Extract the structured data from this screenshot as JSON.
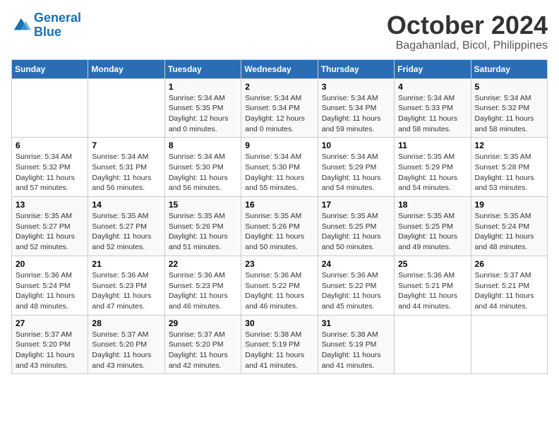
{
  "header": {
    "logo_line1": "General",
    "logo_line2": "Blue",
    "month": "October 2024",
    "location": "Bagahanlad, Bicol, Philippines"
  },
  "weekdays": [
    "Sunday",
    "Monday",
    "Tuesday",
    "Wednesday",
    "Thursday",
    "Friday",
    "Saturday"
  ],
  "weeks": [
    [
      {
        "day": "",
        "info": ""
      },
      {
        "day": "",
        "info": ""
      },
      {
        "day": "1",
        "info": "Sunrise: 5:34 AM\nSunset: 5:35 PM\nDaylight: 12 hours and 0 minutes."
      },
      {
        "day": "2",
        "info": "Sunrise: 5:34 AM\nSunset: 5:34 PM\nDaylight: 12 hours and 0 minutes."
      },
      {
        "day": "3",
        "info": "Sunrise: 5:34 AM\nSunset: 5:34 PM\nDaylight: 11 hours and 59 minutes."
      },
      {
        "day": "4",
        "info": "Sunrise: 5:34 AM\nSunset: 5:33 PM\nDaylight: 11 hours and 58 minutes."
      },
      {
        "day": "5",
        "info": "Sunrise: 5:34 AM\nSunset: 5:32 PM\nDaylight: 11 hours and 58 minutes."
      }
    ],
    [
      {
        "day": "6",
        "info": "Sunrise: 5:34 AM\nSunset: 5:32 PM\nDaylight: 11 hours and 57 minutes."
      },
      {
        "day": "7",
        "info": "Sunrise: 5:34 AM\nSunset: 5:31 PM\nDaylight: 11 hours and 56 minutes."
      },
      {
        "day": "8",
        "info": "Sunrise: 5:34 AM\nSunset: 5:30 PM\nDaylight: 11 hours and 56 minutes."
      },
      {
        "day": "9",
        "info": "Sunrise: 5:34 AM\nSunset: 5:30 PM\nDaylight: 11 hours and 55 minutes."
      },
      {
        "day": "10",
        "info": "Sunrise: 5:34 AM\nSunset: 5:29 PM\nDaylight: 11 hours and 54 minutes."
      },
      {
        "day": "11",
        "info": "Sunrise: 5:35 AM\nSunset: 5:29 PM\nDaylight: 11 hours and 54 minutes."
      },
      {
        "day": "12",
        "info": "Sunrise: 5:35 AM\nSunset: 5:28 PM\nDaylight: 11 hours and 53 minutes."
      }
    ],
    [
      {
        "day": "13",
        "info": "Sunrise: 5:35 AM\nSunset: 5:27 PM\nDaylight: 11 hours and 52 minutes."
      },
      {
        "day": "14",
        "info": "Sunrise: 5:35 AM\nSunset: 5:27 PM\nDaylight: 11 hours and 52 minutes."
      },
      {
        "day": "15",
        "info": "Sunrise: 5:35 AM\nSunset: 5:26 PM\nDaylight: 11 hours and 51 minutes."
      },
      {
        "day": "16",
        "info": "Sunrise: 5:35 AM\nSunset: 5:26 PM\nDaylight: 11 hours and 50 minutes."
      },
      {
        "day": "17",
        "info": "Sunrise: 5:35 AM\nSunset: 5:25 PM\nDaylight: 11 hours and 50 minutes."
      },
      {
        "day": "18",
        "info": "Sunrise: 5:35 AM\nSunset: 5:25 PM\nDaylight: 11 hours and 49 minutes."
      },
      {
        "day": "19",
        "info": "Sunrise: 5:35 AM\nSunset: 5:24 PM\nDaylight: 11 hours and 48 minutes."
      }
    ],
    [
      {
        "day": "20",
        "info": "Sunrise: 5:36 AM\nSunset: 5:24 PM\nDaylight: 11 hours and 48 minutes."
      },
      {
        "day": "21",
        "info": "Sunrise: 5:36 AM\nSunset: 5:23 PM\nDaylight: 11 hours and 47 minutes."
      },
      {
        "day": "22",
        "info": "Sunrise: 5:36 AM\nSunset: 5:23 PM\nDaylight: 11 hours and 46 minutes."
      },
      {
        "day": "23",
        "info": "Sunrise: 5:36 AM\nSunset: 5:22 PM\nDaylight: 11 hours and 46 minutes."
      },
      {
        "day": "24",
        "info": "Sunrise: 5:36 AM\nSunset: 5:22 PM\nDaylight: 11 hours and 45 minutes."
      },
      {
        "day": "25",
        "info": "Sunrise: 5:36 AM\nSunset: 5:21 PM\nDaylight: 11 hours and 44 minutes."
      },
      {
        "day": "26",
        "info": "Sunrise: 5:37 AM\nSunset: 5:21 PM\nDaylight: 11 hours and 44 minutes."
      }
    ],
    [
      {
        "day": "27",
        "info": "Sunrise: 5:37 AM\nSunset: 5:20 PM\nDaylight: 11 hours and 43 minutes."
      },
      {
        "day": "28",
        "info": "Sunrise: 5:37 AM\nSunset: 5:20 PM\nDaylight: 11 hours and 43 minutes."
      },
      {
        "day": "29",
        "info": "Sunrise: 5:37 AM\nSunset: 5:20 PM\nDaylight: 11 hours and 42 minutes."
      },
      {
        "day": "30",
        "info": "Sunrise: 5:38 AM\nSunset: 5:19 PM\nDaylight: 11 hours and 41 minutes."
      },
      {
        "day": "31",
        "info": "Sunrise: 5:38 AM\nSunset: 5:19 PM\nDaylight: 11 hours and 41 minutes."
      },
      {
        "day": "",
        "info": ""
      },
      {
        "day": "",
        "info": ""
      }
    ]
  ]
}
